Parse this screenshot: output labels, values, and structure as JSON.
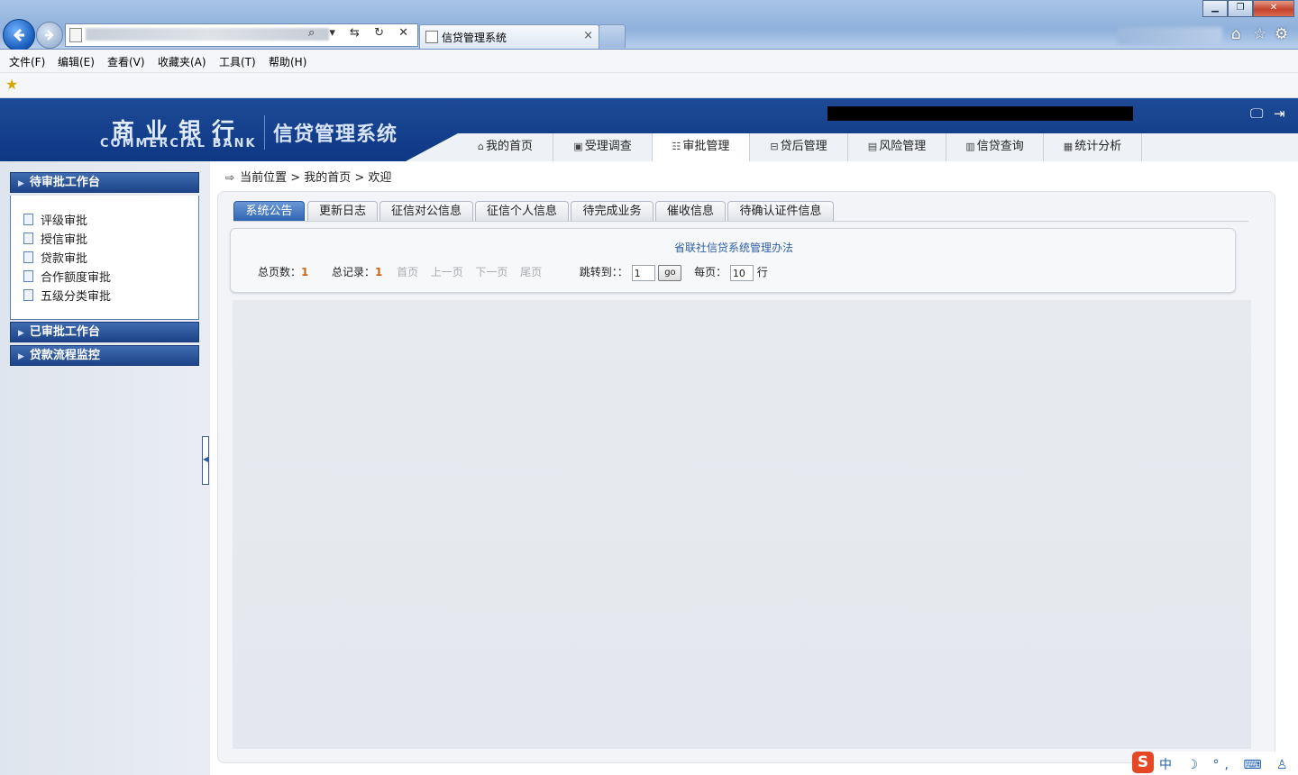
{
  "browser": {
    "tab_title": "信贷管理系统",
    "tab_close": "×",
    "addr_buttons": "⌕ ▾ ⇆ ↻ ✕",
    "menu": [
      "文件(F)",
      "编辑(E)",
      "查看(V)",
      "收藏夹(A)",
      "工具(T)",
      "帮助(H)"
    ],
    "window_buttons": {
      "minimize": "▁",
      "restore": "❐",
      "close": "✕"
    },
    "toolbar_icons": {
      "home": "⌂",
      "favorites": "☆",
      "tools": "⚙"
    }
  },
  "header": {
    "logo_cn": "商业银行",
    "logo_en": "COMMERCIAL BANK",
    "system_title": "信贷管理系统",
    "icons": {
      "screen": "🖵",
      "exit": "⇥"
    },
    "nav": [
      {
        "label": "我的首页",
        "icon": "⌂"
      },
      {
        "label": "受理调查",
        "icon": "▣"
      },
      {
        "label": "审批管理",
        "icon": "☷"
      },
      {
        "label": "贷后管理",
        "icon": "⊟"
      },
      {
        "label": "风险管理",
        "icon": "▤"
      },
      {
        "label": "信贷查询",
        "icon": "▥"
      },
      {
        "label": "统计分析",
        "icon": "▦"
      }
    ],
    "active_nav": "审批管理"
  },
  "sidebar": {
    "sections": [
      {
        "title": "待审批工作台",
        "expanded": true,
        "items": [
          "评级审批",
          "授信审批",
          "贷款审批",
          "合作额度审批",
          "五级分类审批"
        ]
      },
      {
        "title": "已审批工作台",
        "expanded": false,
        "items": []
      },
      {
        "title": "贷款流程监控",
        "expanded": false,
        "items": []
      }
    ]
  },
  "breadcrumb": {
    "text": "当前位置 > 我的首页 > 欢迎"
  },
  "tabs": [
    "系统公告",
    "更新日志",
    "征信对公信息",
    "征信个人信息",
    "待完成业务",
    "催收信息",
    "待确认证件信息"
  ],
  "active_tab": "系统公告",
  "notice": {
    "title": "省联社信贷系统管理办法",
    "pager": {
      "total_pages_label": "总页数：",
      "total_pages": "1",
      "total_records_label": "总记录：",
      "total_records": "1",
      "first": "首页",
      "prev": "上一页",
      "next": "下一页",
      "last": "尾页",
      "jump_label": "跳转到：：",
      "jump_value": "1",
      "go": "go",
      "per_page_label": "每页：",
      "per_page_value": "10",
      "row_unit": "行"
    }
  },
  "tray": {
    "ime": "S",
    "items": "中 ☽ °, ⌨ ♙ ☗ ✎"
  },
  "colors": {
    "brand_blue": "#0e3784",
    "accent_orange": "#d06414",
    "link_blue": "#2d5fa8"
  }
}
